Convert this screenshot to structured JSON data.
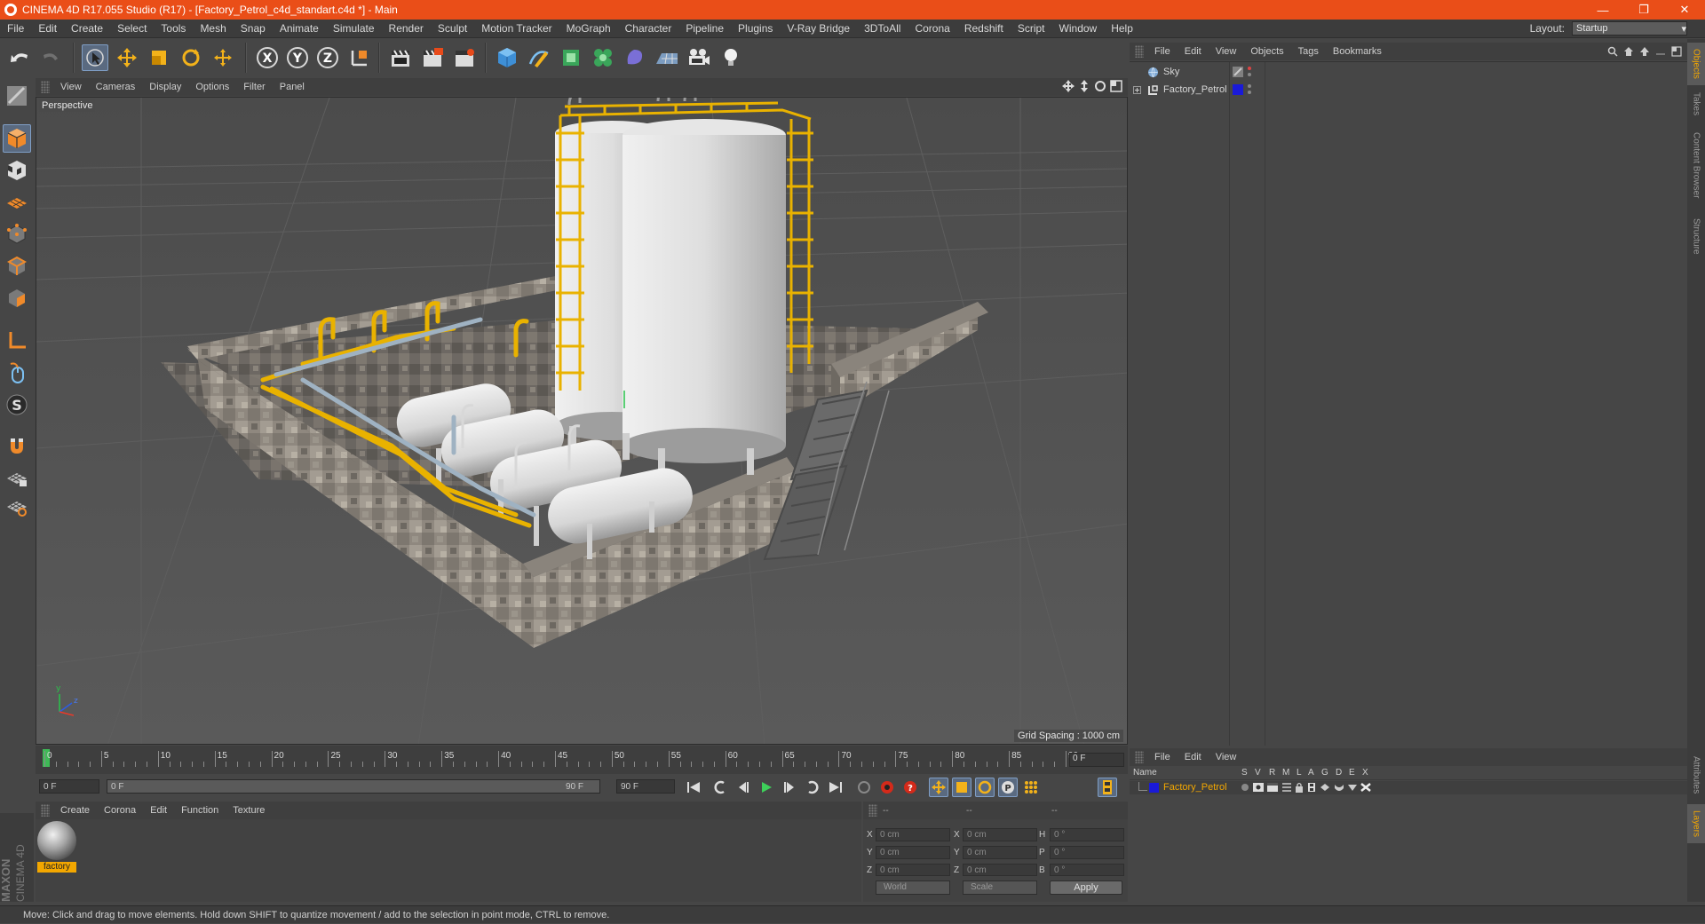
{
  "window": {
    "title": "CINEMA 4D R17.055 Studio (R17) - [Factory_Petrol_c4d_standart.c4d *] - Main",
    "minimize": "—",
    "maximize": "❐",
    "close": "✕"
  },
  "menubar": {
    "items": [
      "File",
      "Edit",
      "Create",
      "Select",
      "Tools",
      "Mesh",
      "Snap",
      "Animate",
      "Simulate",
      "Render",
      "Sculpt",
      "Motion Tracker",
      "MoGraph",
      "Character",
      "Pipeline",
      "Plugins",
      "V-Ray Bridge",
      "3DToAll",
      "Corona",
      "Redshift",
      "Script",
      "Window",
      "Help"
    ],
    "layout_label": "Layout:",
    "layout_value": "Startup"
  },
  "viewport": {
    "menu": [
      "View",
      "Cameras",
      "Display",
      "Options",
      "Filter",
      "Panel"
    ],
    "label": "Perspective",
    "grid_spacing": "Grid Spacing : 1000 cm",
    "axis_y": "y",
    "axis_z": "z"
  },
  "timeline": {
    "ticks": [
      "0",
      "5",
      "10",
      "15",
      "20",
      "25",
      "30",
      "35",
      "40",
      "45",
      "50",
      "55",
      "60",
      "65",
      "70",
      "75",
      "80",
      "85",
      "90"
    ],
    "current_frame": "0 F",
    "start_field": "0 F",
    "range_start": "0 F",
    "range_end": "90 F",
    "end_field": "90 F"
  },
  "materials": {
    "menu": [
      "Create",
      "Corona",
      "Edit",
      "Function",
      "Texture"
    ],
    "items": [
      {
        "name": "factory"
      }
    ]
  },
  "coordinates": {
    "head": [
      "--",
      "--",
      "--"
    ],
    "rows": [
      {
        "l1": "X",
        "v1": "0 cm",
        "l2": "X",
        "v2": "0 cm",
        "l3": "H",
        "v3": "0 °"
      },
      {
        "l1": "Y",
        "v1": "0 cm",
        "l2": "Y",
        "v2": "0 cm",
        "l3": "P",
        "v3": "0 °"
      },
      {
        "l1": "Z",
        "v1": "0 cm",
        "l2": "Z",
        "v2": "0 cm",
        "l3": "B",
        "v3": "0 °"
      }
    ],
    "mode": "World",
    "size_mode": "Scale",
    "apply": "Apply"
  },
  "objects": {
    "menu": [
      "File",
      "Edit",
      "View",
      "Objects",
      "Tags",
      "Bookmarks"
    ],
    "items": [
      {
        "name": "Sky",
        "color": "#9a9a9a"
      },
      {
        "name": "Factory_Petrol",
        "color": "#1a1ad8"
      }
    ]
  },
  "layers": {
    "menu": [
      "File",
      "Edit",
      "View"
    ],
    "columns": [
      "Name",
      "S",
      "V",
      "R",
      "M",
      "L",
      "A",
      "G",
      "D",
      "E",
      "X"
    ],
    "rows": [
      {
        "name": "Factory_Petrol",
        "color": "#1a1ad8"
      }
    ]
  },
  "right_tabs": [
    "Objects",
    "Takes",
    "Content Browser",
    "Structure",
    "Attributes",
    "Layers"
  ],
  "brand": {
    "line1": "MAXON",
    "line2": "CINEMA 4D"
  },
  "status": "Move: Click and drag to move elements. Hold down SHIFT to quantize movement / add to the selection in point mode, CTRL to remove.",
  "colors": {
    "accent": "#ea4e18",
    "selection": "#f3a700",
    "layer_blue": "#1a1ad8"
  }
}
